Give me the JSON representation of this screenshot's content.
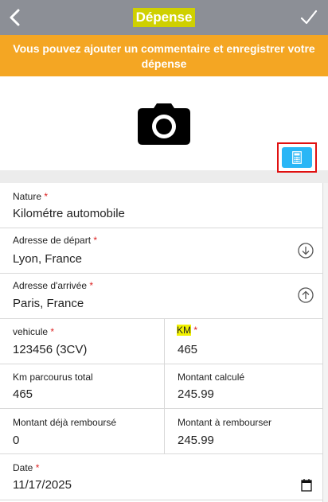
{
  "header": {
    "title": "Dépense",
    "back_icon": "chevron-left-icon",
    "confirm_icon": "checkmark-icon"
  },
  "banner": {
    "text": "Vous pouvez ajouter un commentaire et enregistrer votre dépense",
    "color": "#f4a623"
  },
  "photo": {
    "icon": "camera-icon"
  },
  "form": {
    "nature": {
      "label": "Nature",
      "required": "*",
      "value": "Kilométre automobile"
    },
    "depart": {
      "label": "Adresse de départ",
      "required": "*",
      "value": "Lyon, France"
    },
    "arrivee": {
      "label": "Adresse d'arrivée",
      "required": "*",
      "value": "Paris, France"
    },
    "vehicule": {
      "label": "vehicule",
      "required": "*",
      "value": "123456 (3CV)"
    },
    "km": {
      "label": "KM",
      "required": "*",
      "value": "465"
    },
    "km_total": {
      "label": "Km parcourus total",
      "value": "465"
    },
    "montant_calcule": {
      "label": "Montant calculé",
      "value": "245.99"
    },
    "deja_rembourse": {
      "label": "Montant déjà remboursé",
      "value": "0"
    },
    "a_rembourser": {
      "label": "Montant à rembourser",
      "value": "245.99"
    },
    "date": {
      "label": "Date",
      "required": "*",
      "value": "11/17/2025"
    }
  },
  "colors": {
    "topbar": "#8c8f96",
    "accent": "#29b6f6",
    "required": "#d22"
  }
}
